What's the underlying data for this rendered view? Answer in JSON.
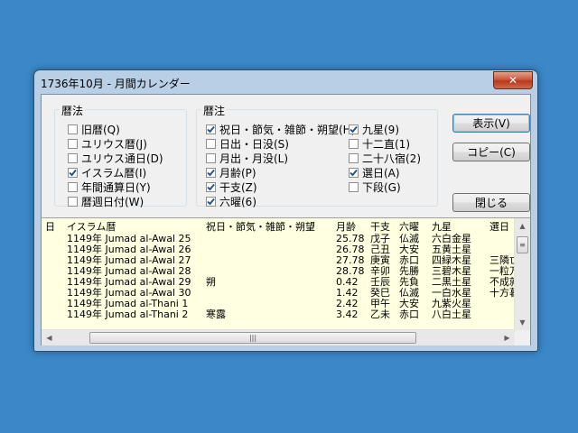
{
  "window": {
    "title": "1736年10月 - 月間カレンダー",
    "close_glyph": "✕"
  },
  "calendar_group": {
    "label": "暦法",
    "items": [
      {
        "label": "旧暦(Q)",
        "checked": false
      },
      {
        "label": "ユリウス暦(J)",
        "checked": false
      },
      {
        "label": "ユリウス通日(D)",
        "checked": false
      },
      {
        "label": "イスラム暦(I)",
        "checked": true
      },
      {
        "label": "年間通算日(Y)",
        "checked": false
      },
      {
        "label": "暦週日付(W)",
        "checked": false
      }
    ]
  },
  "notes_group": {
    "label": "暦注",
    "col1": [
      {
        "label": "祝日・節気・雑節・朔望(H)",
        "checked": true
      },
      {
        "label": "日出・日没(S)",
        "checked": false
      },
      {
        "label": "月出・月没(L)",
        "checked": false
      },
      {
        "label": "月齢(P)",
        "checked": true
      },
      {
        "label": "干支(Z)",
        "checked": true
      },
      {
        "label": "六曜(6)",
        "checked": true
      }
    ],
    "col2": [
      {
        "label": "九星(9)",
        "checked": true
      },
      {
        "label": "十二直(1)",
        "checked": false
      },
      {
        "label": "二十八宿(2)",
        "checked": false
      },
      {
        "label": "選日(A)",
        "checked": true
      },
      {
        "label": "下段(G)",
        "checked": false
      }
    ]
  },
  "buttons": {
    "show": "表示(V)",
    "copy": "コピー(C)",
    "close": "閉じる"
  },
  "list": {
    "headers": [
      "日",
      "イスラム暦",
      "祝日・節気・雑節・朔望",
      "月齢",
      "干支",
      "六曜",
      "九星",
      "選日"
    ],
    "rows": [
      [
        "",
        "1149年 Jumad al-Awal 25",
        "",
        "25.78",
        "戊子",
        "仏滅",
        "六白金星",
        ""
      ],
      [
        "",
        "1149年 Jumad al-Awal 26",
        "",
        "26.78",
        "己丑",
        "大安",
        "五黄土星",
        ""
      ],
      [
        "",
        "1149年 Jumad al-Awal 27",
        "",
        "27.78",
        "庚寅",
        "赤口",
        "四緑木星",
        "三隣亡"
      ],
      [
        "",
        "1149年 Jumad al-Awal 28",
        "",
        "28.78",
        "辛卯",
        "先勝",
        "三碧木星",
        "一粒万"
      ],
      [
        "",
        "1149年 Jumad al-Awal 29",
        "朔",
        "0.42",
        "壬辰",
        "先負",
        "二黒土星",
        "不成就"
      ],
      [
        "",
        "1149年 Jumad al-Awal 30",
        "",
        "1.42",
        "癸巳",
        "仏滅",
        "一白水星",
        "十方暮"
      ],
      [
        "",
        "1149年 Jumad al-Thani 1",
        "",
        "2.42",
        "甲午",
        "大安",
        "九紫火星",
        ""
      ],
      [
        "",
        "1149年 Jumad al-Thani 2",
        "寒露",
        "3.42",
        "乙未",
        "赤口",
        "八白土星",
        ""
      ]
    ]
  },
  "scrollbar": {
    "thumb_grip": "|||",
    "up": "▲",
    "down": "▼",
    "left": "◀",
    "right": "▶"
  }
}
